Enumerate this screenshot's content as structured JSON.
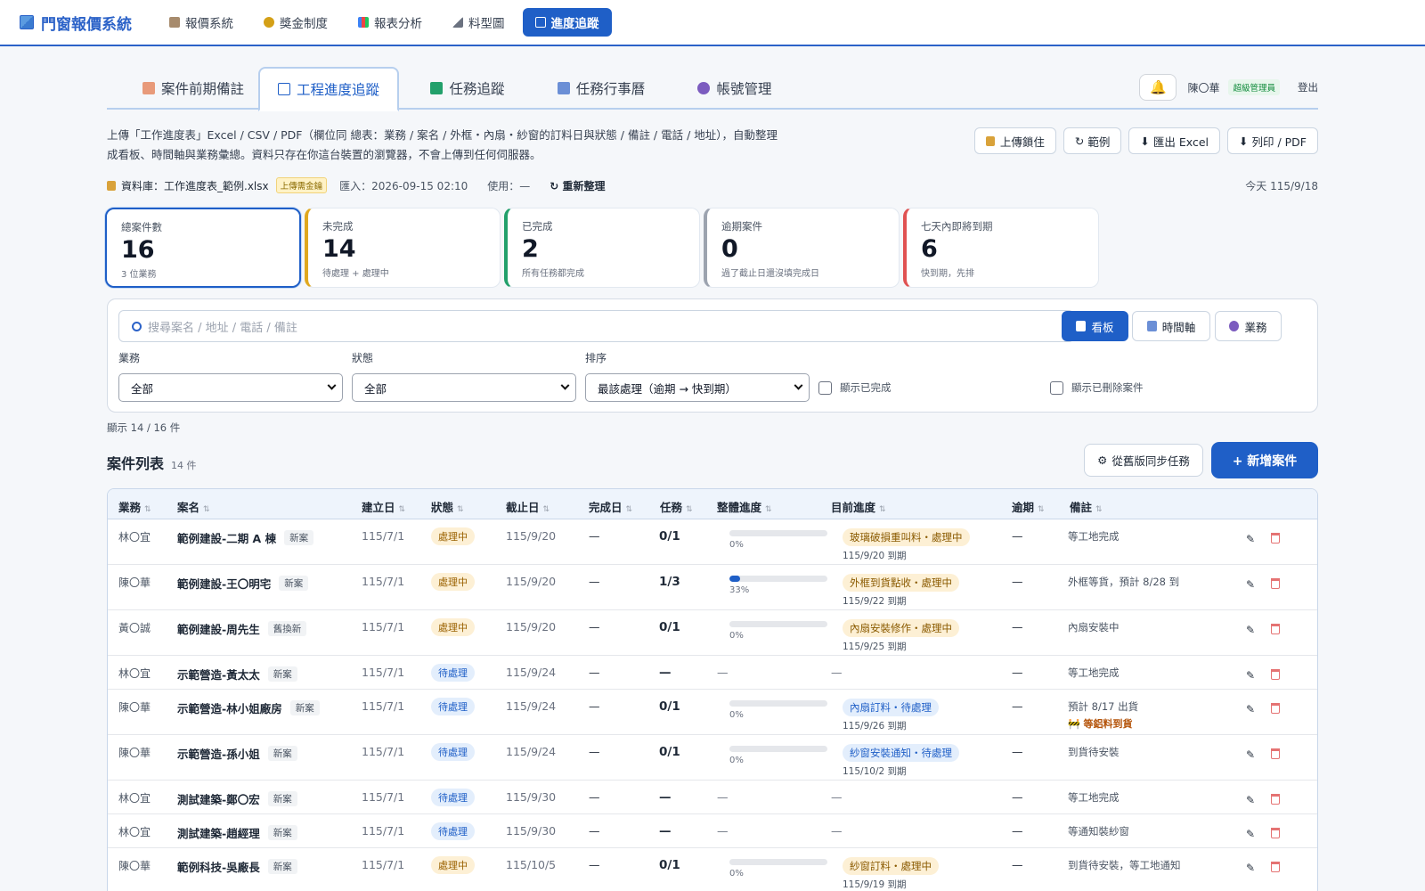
{
  "app": {
    "brand": "門窗報價系統",
    "nav": [
      "報價系統",
      "獎金制度",
      "報表分析",
      "料型圖",
      "進度追蹤"
    ]
  },
  "tabs": [
    "案件前期備註",
    "工程進度追蹤",
    "任務追蹤",
    "任務行事曆",
    "帳號管理"
  ],
  "user": {
    "name": "陳〇華",
    "role": "超級管理員",
    "logout": "登出"
  },
  "intro": "上傳「工作進度表」Excel / CSV / PDF（欄位同 總表：業務 / 案名 / 外框・內扇・紗窗的訂料日與狀態 / 備註 / 電話 / 地址），自動整理成看板、時間軸與業務彙總。資料只存在你這台裝置的瀏覽器，不會上傳到任何伺服器。",
  "actions": [
    "上傳鎖住",
    "範例",
    "匯出 Excel",
    "列印 / PDF"
  ],
  "db": {
    "label": "資料庫：工作進度表_範例.xlsx",
    "badge": "上傳需金鑰",
    "imported": "匯入：2026-09-15 02:10",
    "used": "使用：—",
    "refresh": "重新整理",
    "today": "今天 115/9/18"
  },
  "stats": [
    {
      "label": "總案件數",
      "value": "16",
      "sub": "3 位業務",
      "color": "#1f5fc7"
    },
    {
      "label": "未完成",
      "value": "14",
      "sub": "待處理 + 處理中",
      "color": "#e0a81e"
    },
    {
      "label": "已完成",
      "value": "2",
      "sub": "所有任務都完成",
      "color": "#22a06b"
    },
    {
      "label": "逾期案件",
      "value": "0",
      "sub": "過了截止日還沒填完成日",
      "color": "#9ca3af"
    },
    {
      "label": "七天內即將到期",
      "value": "6",
      "sub": "快到期，先排",
      "color": "#e05252"
    }
  ],
  "filters": {
    "search_placeholder": "搜尋案名 / 地址 / 電話 / 備註",
    "views": [
      "看板",
      "時間軸",
      "業務"
    ],
    "sales_label": "業務",
    "sales_value": "全部",
    "status_label": "狀態",
    "status_value": "全部",
    "sort_label": "排序",
    "sort_value": "最該處理（逾期 → 快到期）",
    "show_done": "顯示已完成",
    "show_deleted": "顯示已刪除案件",
    "shown": "顯示 14 / 16 件"
  },
  "list": {
    "title": "案件列表",
    "count": "14 件",
    "sync": "從舊版同步任務",
    "add": "+ 新增案件",
    "headers": [
      "業務",
      "案名",
      "建立日",
      "狀態",
      "截止日",
      "完成日",
      "任務",
      "整體進度",
      "目前進度",
      "逾期",
      "備註"
    ],
    "rows": [
      {
        "sales": "林〇宜",
        "name": "範例建設-二期 A 棟",
        "tag": "新案",
        "created": "115/7/1",
        "status": "處理中",
        "due": "115/9/20",
        "done": "—",
        "task": "0/1",
        "pct": 0,
        "pct_label": "0%",
        "stage": "玻璃破損重叫料・處理中",
        "stage_due": "115/9/20 到期",
        "overdue": "—",
        "remark": "等工地完成",
        "warn": ""
      },
      {
        "sales": "陳〇華",
        "name": "範例建設-王〇明宅",
        "tag": "新案",
        "created": "115/7/1",
        "status": "處理中",
        "due": "115/9/20",
        "done": "—",
        "task": "1/3",
        "pct": 33,
        "pct_label": "33%",
        "stage": "外框到貨點收・處理中",
        "stage_due": "115/9/22 到期",
        "overdue": "—",
        "remark": "外框等貨，預計 8/28 到",
        "warn": ""
      },
      {
        "sales": "黃〇誠",
        "name": "範例建設-周先生",
        "tag": "舊換新",
        "created": "115/7/1",
        "status": "處理中",
        "due": "115/9/20",
        "done": "—",
        "task": "0/1",
        "pct": 0,
        "pct_label": "0%",
        "stage": "內扇安裝修作・處理中",
        "stage_due": "115/9/25 到期",
        "overdue": "—",
        "remark": "內扇安裝中",
        "warn": ""
      },
      {
        "sales": "林〇宜",
        "name": "示範營造-黃太太",
        "tag": "新案",
        "created": "115/7/1",
        "status": "待處理",
        "due": "115/9/24",
        "done": "—",
        "task": "—",
        "pct": null,
        "pct_label": "—",
        "stage": "",
        "stage_due": "—",
        "overdue": "—",
        "remark": "等工地完成",
        "warn": ""
      },
      {
        "sales": "陳〇華",
        "name": "示範營造-林小姐廠房",
        "tag": "新案",
        "created": "115/7/1",
        "status": "待處理",
        "due": "115/9/24",
        "done": "—",
        "task": "0/1",
        "pct": 0,
        "pct_label": "0%",
        "stage": "內扇訂料・待處理",
        "stage_due": "115/9/26 到期",
        "overdue": "—",
        "remark": "預計 8/17 出貨",
        "warn": "🚧 等鋁料到貨"
      },
      {
        "sales": "陳〇華",
        "name": "示範營造-孫小姐",
        "tag": "新案",
        "created": "115/7/1",
        "status": "待處理",
        "due": "115/9/24",
        "done": "—",
        "task": "0/1",
        "pct": 0,
        "pct_label": "0%",
        "stage": "紗窗安裝通知・待處理",
        "stage_due": "115/10/2 到期",
        "overdue": "—",
        "remark": "到貨待安裝",
        "warn": ""
      },
      {
        "sales": "林〇宜",
        "name": "測試建築-鄭〇宏",
        "tag": "新案",
        "created": "115/7/1",
        "status": "待處理",
        "due": "115/9/30",
        "done": "—",
        "task": "—",
        "pct": null,
        "pct_label": "—",
        "stage": "",
        "stage_due": "—",
        "overdue": "—",
        "remark": "等工地完成",
        "warn": ""
      },
      {
        "sales": "林〇宜",
        "name": "測試建築-趙經理",
        "tag": "新案",
        "created": "115/7/1",
        "status": "待處理",
        "due": "115/9/30",
        "done": "—",
        "task": "—",
        "pct": null,
        "pct_label": "—",
        "stage": "",
        "stage_due": "—",
        "overdue": "—",
        "remark": "等通知裝紗窗",
        "warn": ""
      },
      {
        "sales": "陳〇華",
        "name": "範例科技-吳廠長",
        "tag": "新案",
        "created": "115/7/1",
        "status": "處理中",
        "due": "115/10/5",
        "done": "—",
        "task": "0/1",
        "pct": 0,
        "pct_label": "0%",
        "stage": "紗窗訂料・處理中",
        "stage_due": "115/9/19 到期",
        "overdue": "—",
        "remark": "到貨待安裝，等工地通知",
        "warn": ""
      }
    ]
  }
}
